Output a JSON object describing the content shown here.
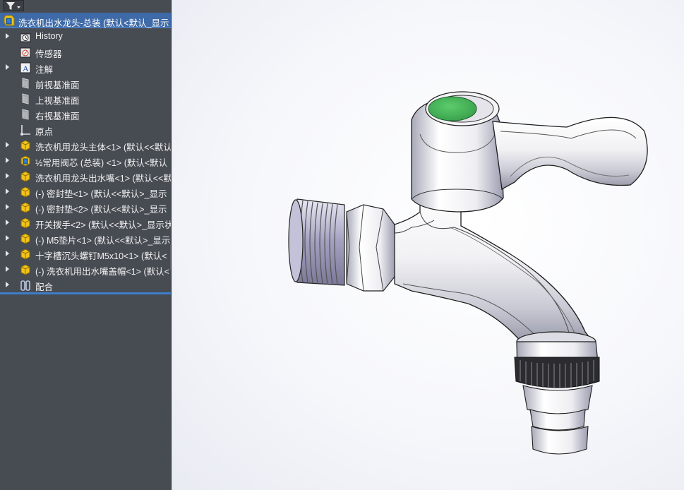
{
  "feature_tree": {
    "root_label": "洗衣机出水龙头-总装 (默认<默认_显示",
    "items": [
      {
        "label": "History",
        "icon": "history-folder-icon",
        "expandable": true
      },
      {
        "label": "传感器",
        "icon": "sensor-icon",
        "expandable": false
      },
      {
        "label": "注解",
        "icon": "annotation-icon",
        "expandable": true
      },
      {
        "label": "前视基准面",
        "icon": "plane-icon",
        "expandable": false
      },
      {
        "label": "上视基准面",
        "icon": "plane-icon",
        "expandable": false
      },
      {
        "label": "右视基准面",
        "icon": "plane-icon",
        "expandable": false
      },
      {
        "label": "原点",
        "icon": "origin-icon",
        "expandable": false
      },
      {
        "label": "洗衣机用龙头主体<1> (默认<<默认",
        "icon": "part-icon",
        "expandable": true
      },
      {
        "label": "½常用阀芯 (总装) <1> (默认<默认",
        "icon": "subassembly-icon",
        "expandable": true
      },
      {
        "label": "洗衣机用龙头出水嘴<1> (默认<<默",
        "icon": "part-icon",
        "expandable": true
      },
      {
        "label": "(-) 密封垫<1> (默认<<默认>_显示",
        "icon": "part-icon",
        "expandable": true
      },
      {
        "label": "(-) 密封垫<2> (默认<<默认>_显示",
        "icon": "part-icon",
        "expandable": true
      },
      {
        "label": "开关拨手<2> (默认<<默认>_显示状",
        "icon": "part-icon",
        "expandable": true
      },
      {
        "label": "(-) M5垫片<1> (默认<<默认>_显示",
        "icon": "part-icon",
        "expandable": true
      },
      {
        "label": "十字槽沉头螺钉M5x10<1> (默认<",
        "icon": "part-icon",
        "expandable": true
      },
      {
        "label": "(-) 洗衣机用出水嘴盖帽<1> (默认<",
        "icon": "part-icon",
        "expandable": true
      },
      {
        "label": "配合",
        "icon": "mates-icon",
        "expandable": true
      }
    ]
  },
  "colors": {
    "panel_bg": "#474b52",
    "selection": "#3e6aa8",
    "part_icon": "#f2c31b",
    "handle_cap": "#4cbb5f"
  }
}
